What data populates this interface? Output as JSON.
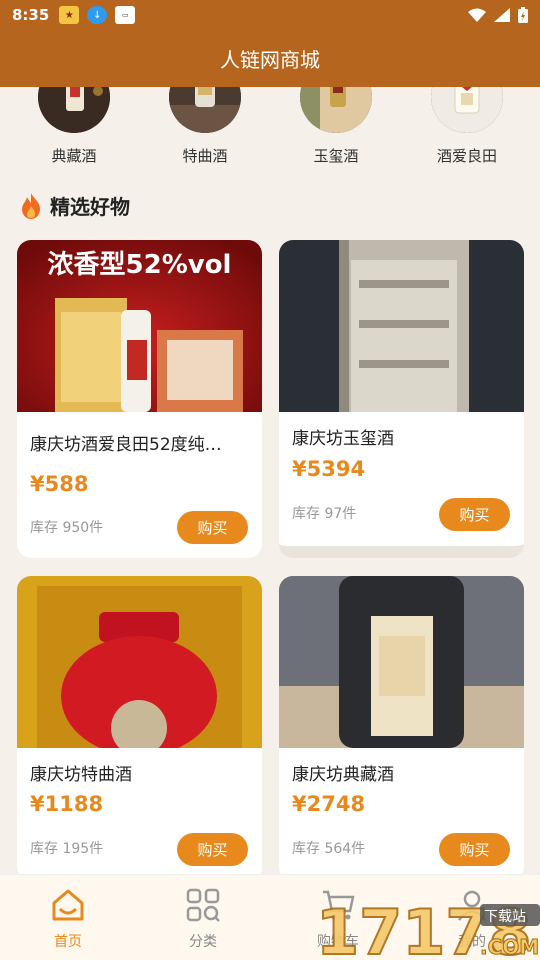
{
  "status_bar": {
    "time": "8:35"
  },
  "header": {
    "title": "人链网商城"
  },
  "categories": [
    {
      "label": "典藏酒"
    },
    {
      "label": "特曲酒"
    },
    {
      "label": "玉玺酒"
    },
    {
      "label": "酒爱良田"
    }
  ],
  "section": {
    "title": "精选好物"
  },
  "products": [
    {
      "name": "康庆坊酒爱良田52度纯…",
      "price": "¥588",
      "stock": "库存 950件",
      "buy_label": "购买",
      "banner": "浓香型52%vol"
    },
    {
      "name": "康庆坊玉玺酒",
      "price": "¥5394",
      "stock": "库存 97件",
      "buy_label": "购买"
    },
    {
      "name": "康庆坊特曲酒",
      "price": "¥1188",
      "stock": "库存 195件",
      "buy_label": "购买"
    },
    {
      "name": "康庆坊典藏酒",
      "price": "¥2748",
      "stock": "库存 564件",
      "buy_label": "购买"
    }
  ],
  "nav": [
    {
      "label": "首页",
      "icon": "home-icon",
      "active": true
    },
    {
      "label": "分类",
      "icon": "category-icon"
    },
    {
      "label": "购物车",
      "icon": "cart-icon"
    },
    {
      "label": "我的",
      "icon": "profile-icon"
    }
  ],
  "watermark": {
    "text": "17178",
    "sub": ".COM",
    "tag": "下载站"
  },
  "colors": {
    "brand": "#b5651d",
    "accent": "#e8891e"
  }
}
